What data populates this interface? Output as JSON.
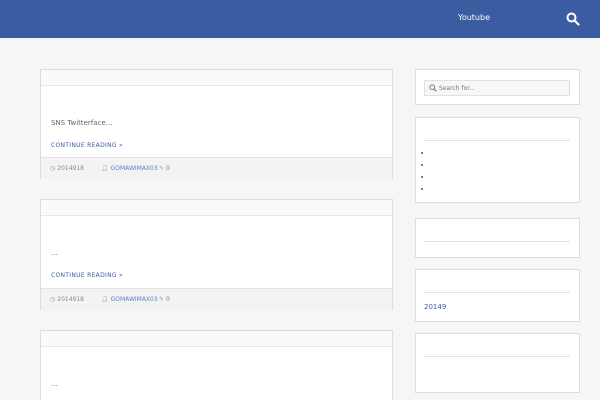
{
  "header": {
    "site_title": "",
    "nav_link": "Youtube"
  },
  "posts": [
    {
      "category": "",
      "title": "",
      "excerpt": "SNS Twitterface…",
      "more": "CONTINUE READING »",
      "date": "2014918",
      "author": "GOMAWIMAX03",
      "comments": "0"
    },
    {
      "category": "",
      "title": "",
      "excerpt": "…",
      "more": "CONTINUE READING »",
      "date": "2014918",
      "author": "GOMAWIMAX03",
      "comments": "0"
    },
    {
      "category": "",
      "title": "",
      "excerpt": "…"
    }
  ],
  "sidebar": {
    "search_placeholder": "Search for...",
    "recent": {
      "title": "",
      "items": [
        "",
        "",
        "",
        ""
      ]
    },
    "comments_widget": {
      "title": ""
    },
    "archive": {
      "title": "",
      "link": "20149"
    },
    "categories": {
      "title": "",
      "link": ""
    }
  },
  "colors": {
    "header_bg": "#3b5ca0",
    "link": "#3b5ca0",
    "page_bg": "#f6f6f6"
  }
}
